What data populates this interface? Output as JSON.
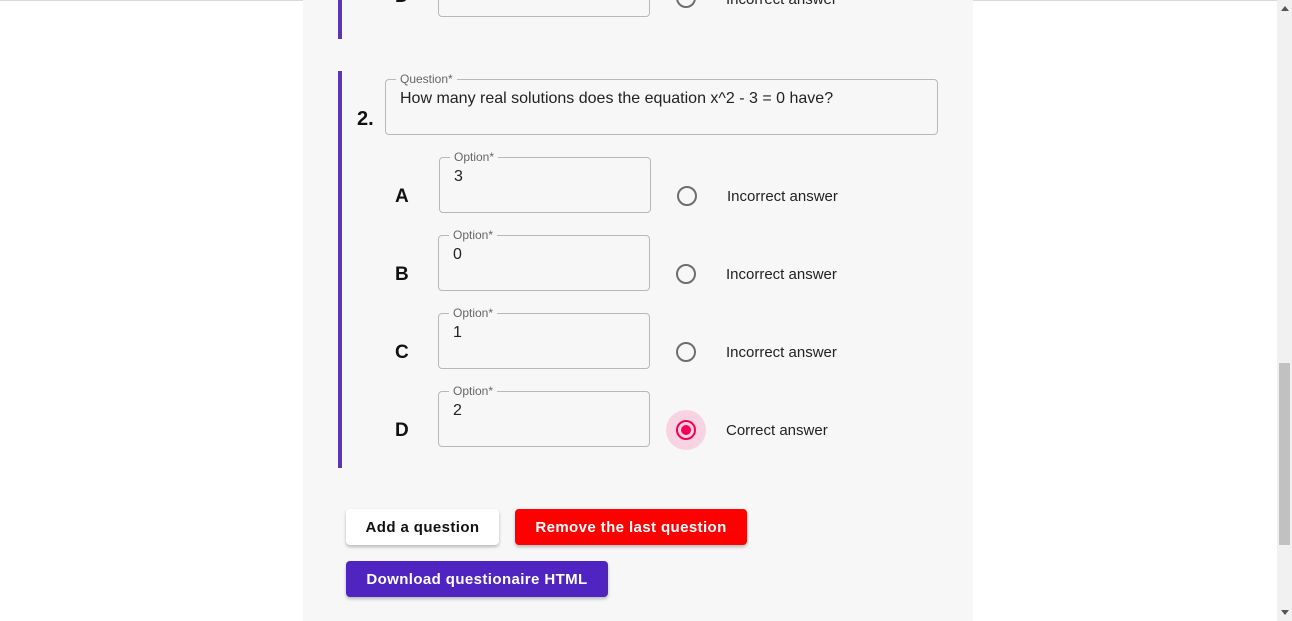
{
  "previous_question": {
    "letter": "D",
    "answer_label": "Incorrect answer"
  },
  "question": {
    "number": "2.",
    "label": "Question*",
    "text": "How many real solutions does the equation x^2 - 3 = 0 have?",
    "options": [
      {
        "letter": "A",
        "label": "Option*",
        "value": "3",
        "answer_label": "Incorrect answer",
        "selected": false
      },
      {
        "letter": "B",
        "label": "Option*",
        "value": "0",
        "answer_label": "Incorrect answer",
        "selected": false
      },
      {
        "letter": "C",
        "label": "Option*",
        "value": "1",
        "answer_label": "Incorrect answer",
        "selected": false
      },
      {
        "letter": "D",
        "label": "Option*",
        "value": "2",
        "answer_label": "Correct answer",
        "selected": true
      }
    ]
  },
  "actions": {
    "add_label": "Add a question",
    "remove_label": "Remove the last question",
    "download_label": "Download questionaire HTML"
  },
  "colors": {
    "accent_bar": "#5e35b1",
    "radio_selected": "#f50057",
    "remove_button": "#ff0000",
    "download_button": "#5024c0"
  }
}
